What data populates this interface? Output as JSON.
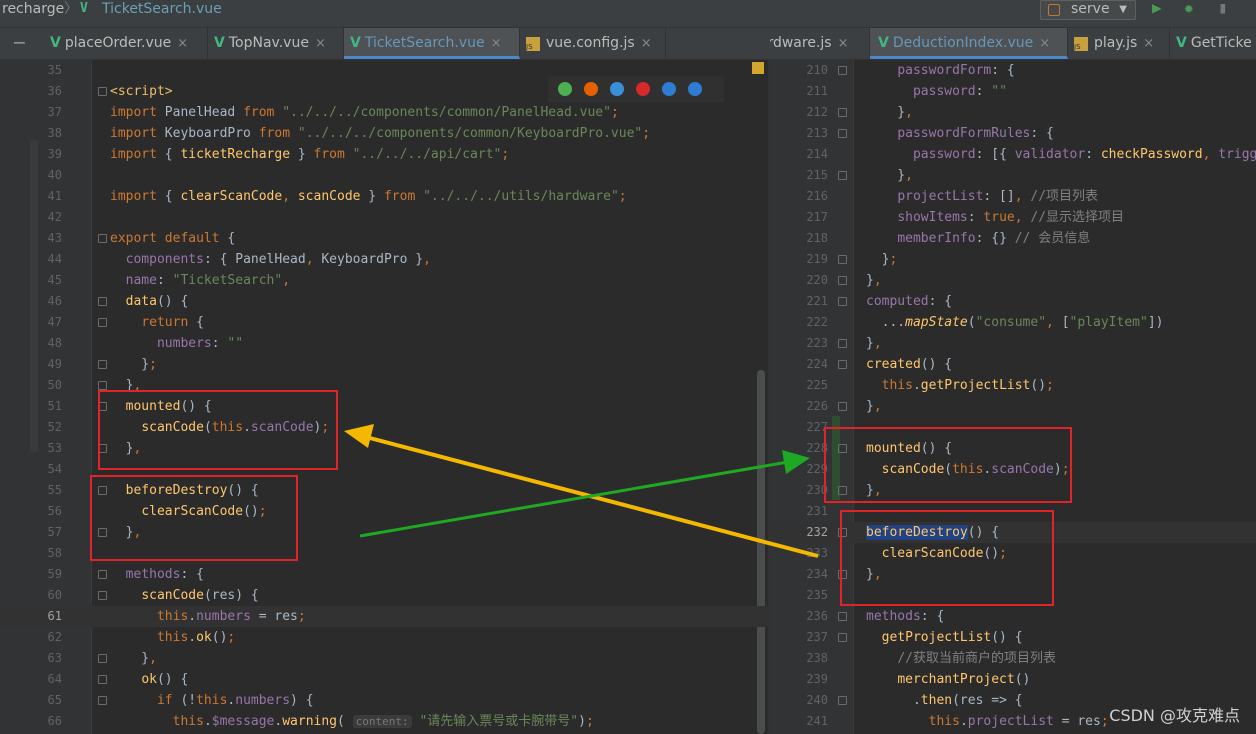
{
  "breadcrumb": {
    "project": "recharge",
    "sep": "〉",
    "file": "TicketSearch.vue"
  },
  "toolbar": {
    "run_config": "serve",
    "dropdown_glyph": "▼"
  },
  "tabs": [
    {
      "label": "placeOrder.vue",
      "kind": "vue",
      "close": "×"
    },
    {
      "label": "TopNav.vue",
      "kind": "vue",
      "close": "×"
    },
    {
      "label": "TicketSearch.vue",
      "kind": "vue",
      "close": "×"
    },
    {
      "label": "vue.config.js",
      "kind": "js",
      "close": "×"
    },
    {
      "label": "hardware.js",
      "kind": "js",
      "close": "×"
    },
    {
      "label": "DeductionIndex.vue",
      "kind": "vue",
      "close": "×"
    },
    {
      "label": "play.js",
      "kind": "js",
      "close": "×"
    },
    {
      "label": "GetTicke",
      "kind": "vue",
      "close": ""
    }
  ],
  "editor_left": {
    "numbers": [
      "35",
      "36",
      "37",
      "38",
      "39",
      "40",
      "41",
      "42",
      "43",
      "44",
      "45",
      "46",
      "47",
      "48",
      "49",
      "50",
      "51",
      "52",
      "53",
      "54",
      "55",
      "56",
      "57",
      "58",
      "59",
      "60",
      "61",
      "62",
      "63",
      "64",
      "65",
      "66"
    ],
    "current_line": "61"
  },
  "editor_right": {
    "numbers": [
      "210",
      "211",
      "212",
      "213",
      "214",
      "215",
      "216",
      "217",
      "218",
      "219",
      "220",
      "221",
      "222",
      "223",
      "224",
      "225",
      "226",
      "227",
      "228",
      "229",
      "230",
      "231",
      "232",
      "233",
      "234",
      "235",
      "236",
      "237",
      "238",
      "239",
      "240",
      "241"
    ],
    "current_line": "232"
  },
  "hint": {
    "param_name": "content:"
  },
  "watermark": "CSDN @攻克难点",
  "colors": {
    "annotation_red": "#e0242a",
    "arrow_yellow": "#f5b800",
    "arrow_green": "#1fa822"
  }
}
